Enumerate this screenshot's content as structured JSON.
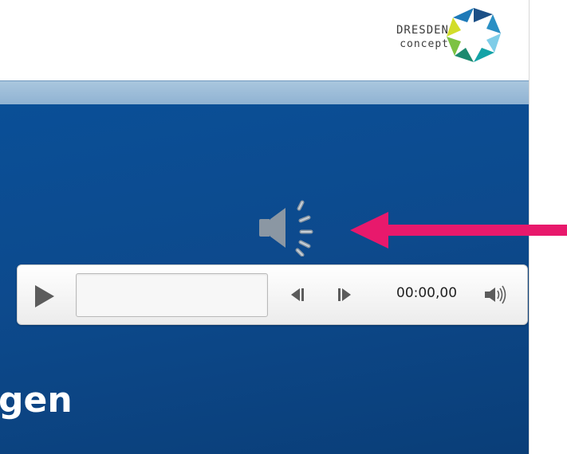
{
  "logo": {
    "line1": "DRESDEN",
    "line2": "concept",
    "icon": "dresden-concept-hexagon-logo"
  },
  "slide": {
    "partial_title": "gen",
    "background_color": "#0d4a8d",
    "stripe_color": "#9dbdd9"
  },
  "annotation": {
    "arrow_color": "#e8196c"
  },
  "audio": {
    "speaker_icon": "speaker-sound-icon",
    "player": {
      "play_icon": "play-icon",
      "skip_back_icon": "skip-back-icon",
      "skip_forward_icon": "skip-forward-icon",
      "time": "00:00,00",
      "volume_icon": "volume-icon"
    }
  }
}
